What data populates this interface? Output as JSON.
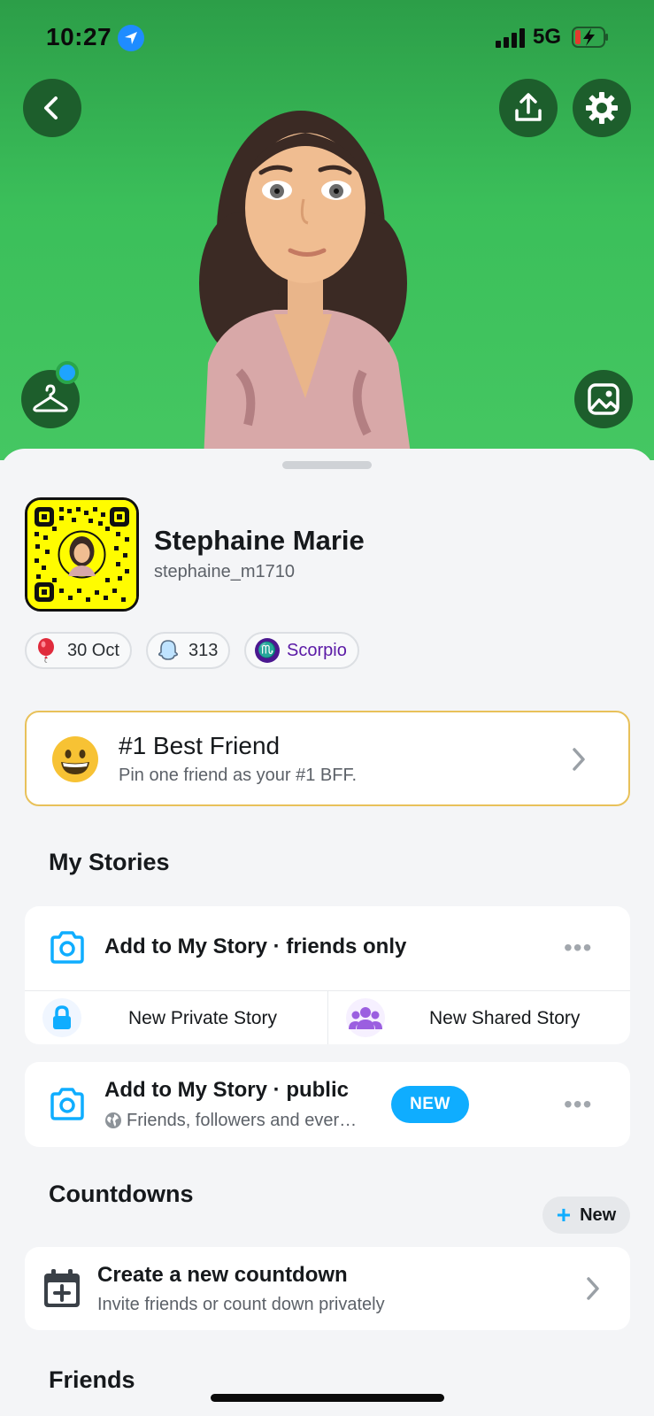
{
  "status_bar": {
    "time": "10:27",
    "network": "5G"
  },
  "profile": {
    "display_name": "Stephaine Marie",
    "username": "stephaine_m1710",
    "chips": [
      {
        "icon": "balloon-icon",
        "label": "30 Oct"
      },
      {
        "icon": "ghost-icon",
        "label": "313"
      },
      {
        "icon": "scorpio-icon",
        "label": "Scorpio",
        "glyph": "♏"
      }
    ]
  },
  "best_friend": {
    "title": "#1 Best Friend",
    "subtitle": "Pin one friend as your #1 BFF."
  },
  "my_stories": {
    "title": "My Stories",
    "friends_story_label": "Add to My Story · friends only",
    "private_story_label": "New Private Story",
    "shared_story_label": "New Shared Story",
    "public_story_label": "Add to My Story · public",
    "public_story_sub": "Friends, followers and ever…",
    "new_badge": "NEW",
    "more_glyph": "•••"
  },
  "countdowns": {
    "title": "Countdowns",
    "new_button_label": "New",
    "create_title": "Create a new countdown",
    "create_sub": "Invite friends or count down privately"
  },
  "friends": {
    "title": "Friends"
  },
  "colors": {
    "hero_green": "#3bbf5a",
    "accent_blue": "#0fadff",
    "bff_border": "#e8c15a"
  }
}
